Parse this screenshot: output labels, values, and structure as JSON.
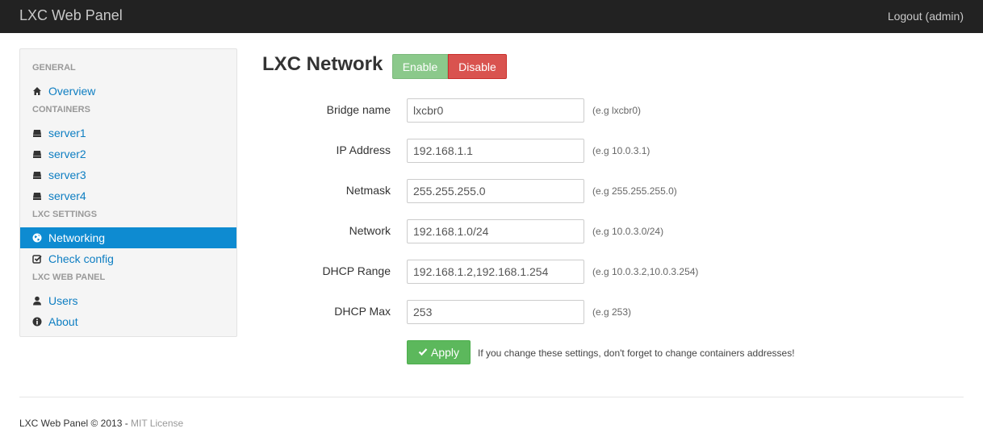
{
  "navbar": {
    "brand": "LXC Web Panel",
    "logout": "Logout (admin)"
  },
  "sidebar": {
    "sections": [
      {
        "header": "GENERAL",
        "items": [
          {
            "label": "Overview",
            "icon": "home-icon"
          }
        ]
      },
      {
        "header": "CONTAINERS",
        "items": [
          {
            "label": "server1",
            "icon": "server-icon"
          },
          {
            "label": "server2",
            "icon": "server-icon"
          },
          {
            "label": "server3",
            "icon": "server-icon"
          },
          {
            "label": "server4",
            "icon": "server-icon"
          }
        ]
      },
      {
        "header": "LXC SETTINGS",
        "items": [
          {
            "label": "Networking",
            "icon": "globe-icon",
            "active": true
          },
          {
            "label": "Check config",
            "icon": "check-square-icon"
          }
        ]
      },
      {
        "header": "LXC WEB PANEL",
        "items": [
          {
            "label": "Users",
            "icon": "user-icon"
          },
          {
            "label": "About",
            "icon": "info-icon"
          }
        ]
      }
    ]
  },
  "main": {
    "title": "LXC Network",
    "enable_label": "Enable",
    "disable_label": "Disable",
    "fields": [
      {
        "label": "Bridge name",
        "value": "lxcbr0",
        "help": "(e.g lxcbr0)"
      },
      {
        "label": "IP Address",
        "value": "192.168.1.1",
        "help": "(e.g 10.0.3.1)"
      },
      {
        "label": "Netmask",
        "value": "255.255.255.0",
        "help": "(e.g 255.255.255.0)"
      },
      {
        "label": "Network",
        "value": "192.168.1.0/24",
        "help": "(e.g 10.0.3.0/24)"
      },
      {
        "label": "DHCP Range",
        "value": "192.168.1.2,192.168.1.254",
        "help": "(e.g 10.0.3.2,10.0.3.254)"
      },
      {
        "label": "DHCP Max",
        "value": "253",
        "help": "(e.g 253)"
      }
    ],
    "apply_label": "Apply",
    "apply_note": "If you change these settings, don't forget to change containers addresses!"
  },
  "footer": {
    "text": "LXC Web Panel © 2013 - ",
    "link": "MIT License"
  },
  "colors": {
    "navbar": "#222222",
    "active": "#0e8bd1",
    "link": "#0e7ec2",
    "success": "#5cb85c",
    "danger": "#d9534f"
  }
}
